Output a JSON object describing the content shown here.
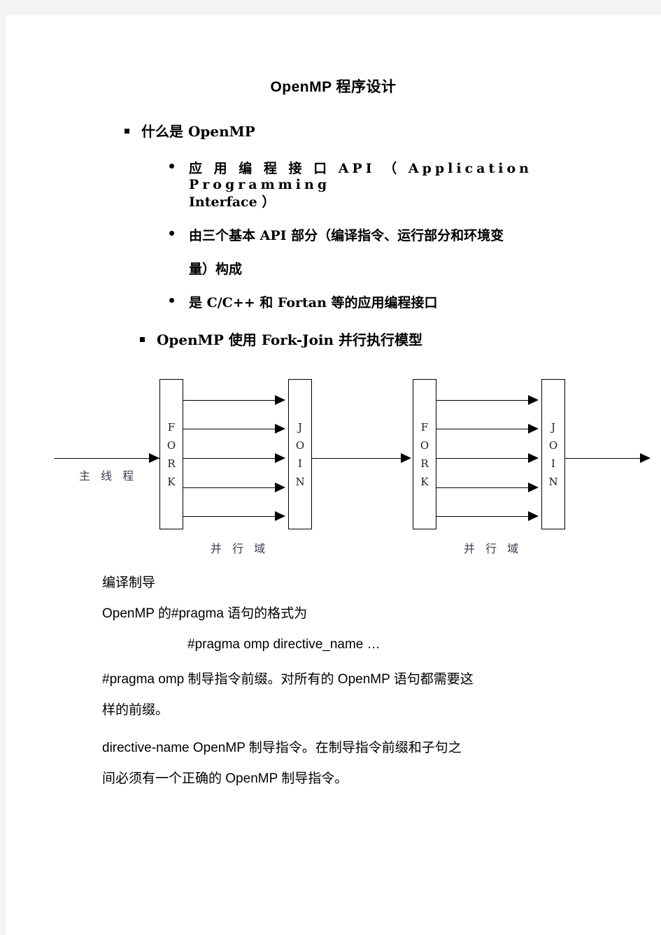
{
  "document": {
    "title": "OpenMP 程序设计"
  },
  "outline": {
    "item1": {
      "text": "什么是 OpenMP",
      "children": [
        "应 用 编 程 接 口  API  （ Application     Programming Interface  ）",
        "由三个基本 API 部分（编译指令、运行部分和环境变量）构成",
        "是 C/C++  和 Fortan 等的应用编程接口"
      ]
    },
    "item2": {
      "text": "OpenMP 使用 Fork-Join 并行执行模型"
    }
  },
  "outline_lines": {
    "sub1_line1": "应 用 编 程 接 口   API  （ Application     Programming",
    "sub1_line2": "Interface   ）",
    "sub2_line1": "由三个基本 API 部分（编译指令、运行部分和环境变",
    "sub2_line2": "量）构成",
    "sub3_line1": "是 C/C++   和 Fortan 等的应用编程接口"
  },
  "diagram": {
    "type": "fork-join-parallel-execution-model",
    "main_thread_label": "主 线 程",
    "fork_label_letters": [
      "F",
      "O",
      "R",
      "K"
    ],
    "join_label_letters": [
      "J",
      "O",
      "I",
      "N"
    ],
    "region_label_1": "并 行 域",
    "region_label_2": "并 行 域",
    "thread_count": 5,
    "stages": 2
  },
  "body": {
    "heading": "编译制导",
    "line1": "OpenMP 的#pragma 语句的格式为",
    "code": "#pragma  omp  directive_name  …",
    "para2_line1": "#pragma omp    制导指令前缀。对所有的 OpenMP 语句都需要这",
    "para2_line2": "样的前缀。",
    "para3_line1": "directive-name      OpenMP  制导指令。在制导指令前缀和子句之",
    "para3_line2": "间必须有一个正确的 OpenMP 制导指令。"
  }
}
